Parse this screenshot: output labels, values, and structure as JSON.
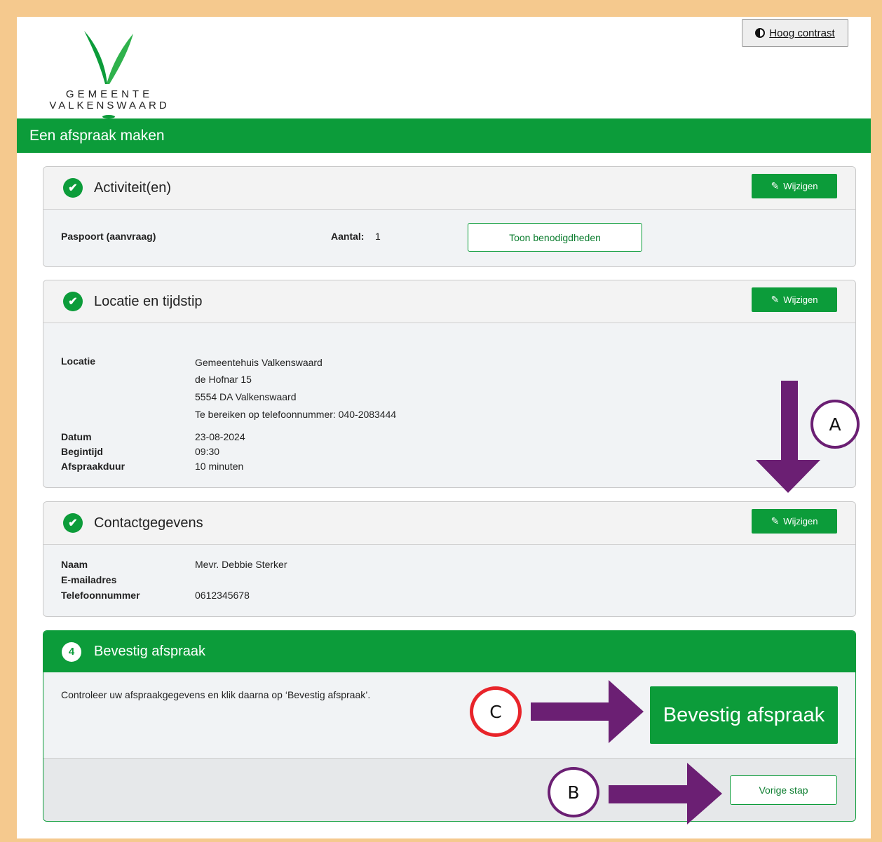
{
  "branding": {
    "line1": "GEMEENTE",
    "line2": "VALKENSWAARD",
    "colors": {
      "green": "#0c9c3a",
      "frame": "#f5c98e",
      "annotation_purple": "#6b1f73",
      "annotation_red": "#e8242a"
    }
  },
  "contrast": {
    "label": "Hoog contrast",
    "icon": "contrast-icon"
  },
  "header": {
    "title": "Een afspraak maken"
  },
  "activities": {
    "title": "Activiteit(en)",
    "edit_label": "Wijzigen",
    "item_name": "Paspoort (aanvraag)",
    "count_label": "Aantal:",
    "count_value": "1",
    "requirements_button": "Toon benodigdheden"
  },
  "location": {
    "title": "Locatie en tijdstip",
    "edit_label": "Wijzigen",
    "location_label": "Locatie",
    "address_lines": [
      "Gemeentehuis Valkenswaard",
      "de Hofnar 15",
      "5554 DA Valkenswaard",
      "Te bereiken op telefoonnummer: 040-2083444"
    ],
    "date_label": "Datum",
    "date_value": "23-08-2024",
    "start_label": "Begintijd",
    "start_value": "09:30",
    "duration_label": "Afspraakduur",
    "duration_value": "10 minuten"
  },
  "contact": {
    "title": "Contactgegevens",
    "edit_label": "Wijzigen",
    "name_label": "Naam",
    "name_value": "Mevr. Debbie Sterker",
    "email_label": "E-mailadres",
    "email_value": "",
    "phone_label": "Telefoonnummer",
    "phone_value": "0612345678"
  },
  "confirm": {
    "step_number": "4",
    "title": "Bevestig afspraak",
    "instruction": "Controleer uw afspraakgegevens en klik daarna op ‘Bevestig afspraak’.",
    "confirm_button": "Bevestig afspraak",
    "previous_button": "Vorige stap"
  },
  "annotations": {
    "a": "A",
    "b": "B",
    "c": "C"
  }
}
